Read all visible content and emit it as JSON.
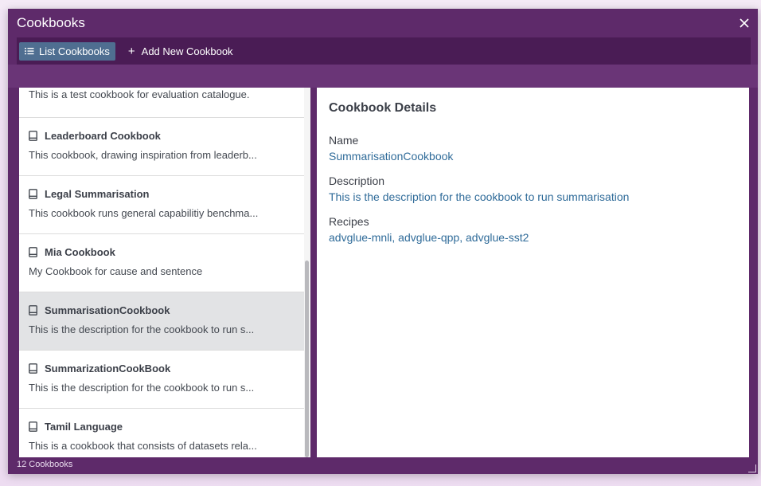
{
  "window": {
    "title": "Cookbooks",
    "close_icon": "close-icon"
  },
  "toolbar": {
    "list_label": "List Cookbooks",
    "add_label": "Add New Cookbook"
  },
  "cookbooks": {
    "partial_item_desc": "This is a test cookbook for evaluation catalogue.",
    "items": [
      {
        "name": "Leaderboard Cookbook",
        "desc": "This cookbook, drawing inspiration from leaderb..."
      },
      {
        "name": "Legal Summarisation",
        "desc": "This cookbook runs general capabilitiy benchma..."
      },
      {
        "name": "Mia Cookbook",
        "desc": "My Cookbook for cause and sentence"
      },
      {
        "name": "SummarisationCookbook",
        "desc": "This is the description for the cookbook to run s...",
        "selected": true
      },
      {
        "name": "SummarizationCookBook",
        "desc": "This is the description for the cookbook to run s..."
      },
      {
        "name": "Tamil Language",
        "desc": "This is a cookbook that consists of datasets rela..."
      }
    ]
  },
  "details": {
    "heading": "Cookbook Details",
    "name_label": "Name",
    "name_value": "SummarisationCookbook",
    "description_label": "Description",
    "description_value": "This is the description for the cookbook to run summarisation",
    "recipes_label": "Recipes",
    "recipes_value": "advglue-mnli, advglue-qpp, advglue-sst2"
  },
  "status": {
    "count_text": "12 Cookbooks"
  },
  "colors": {
    "window_bg": "#5e2a6a",
    "toolbar_bg": "#4a1c55",
    "active_tab": "#4f6e91",
    "link_value": "#2f6b99",
    "selected_row": "#e2e3e5"
  }
}
